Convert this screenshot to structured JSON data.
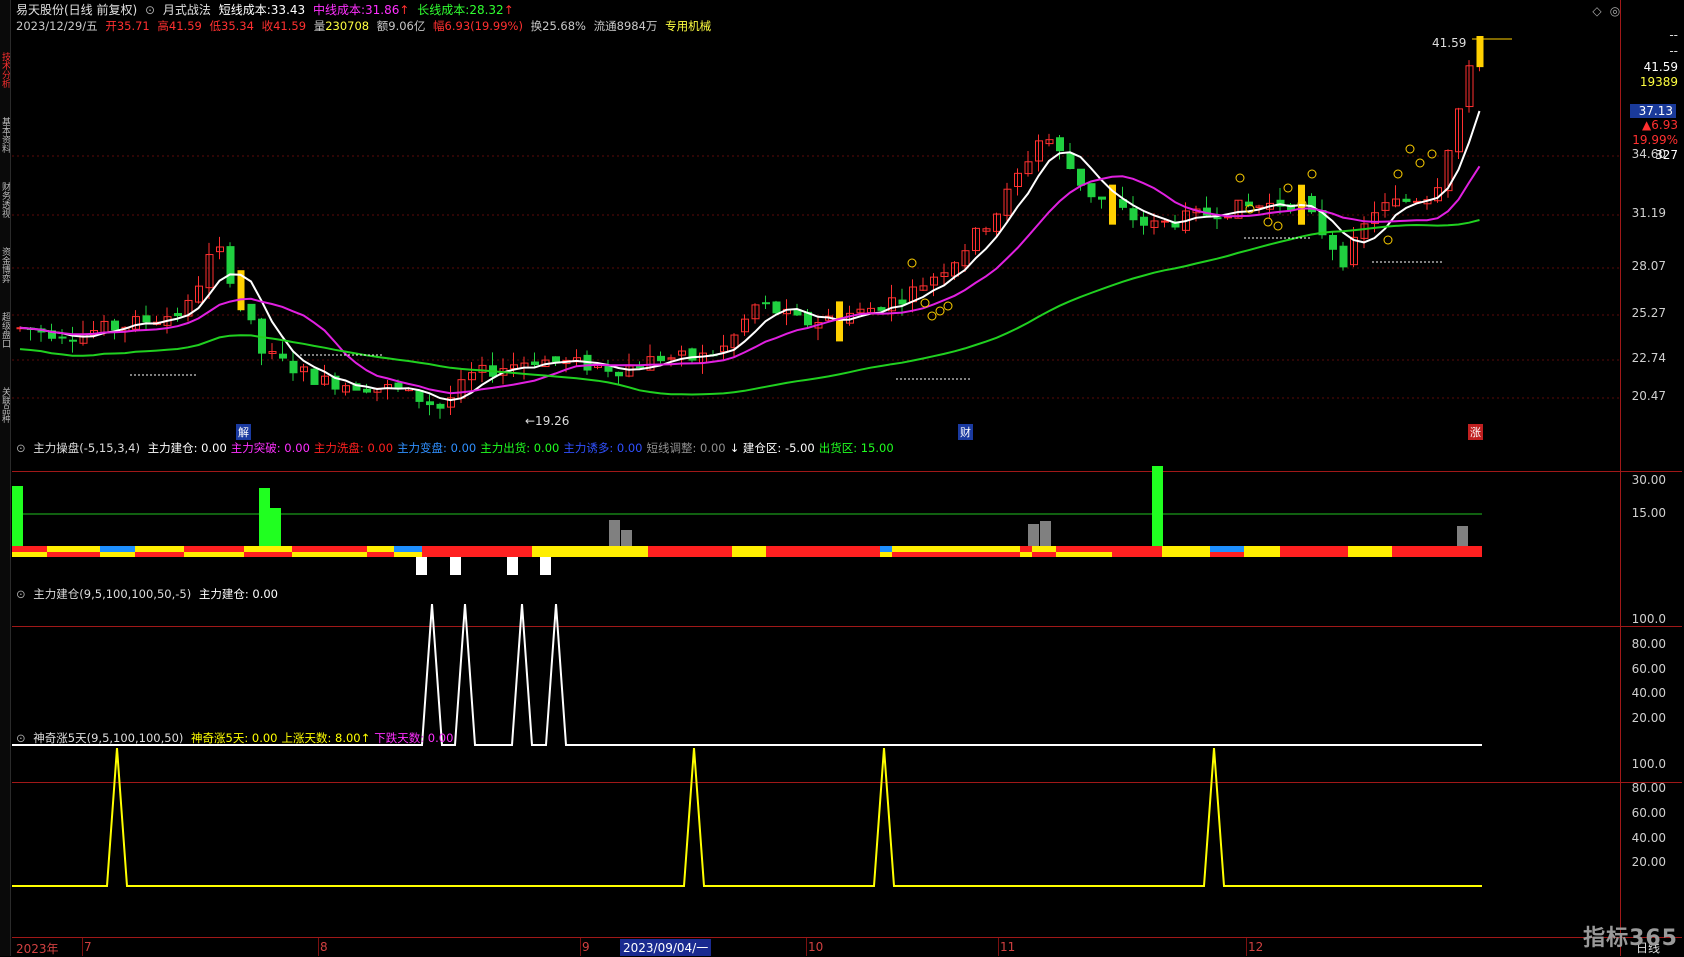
{
  "sidebar": {
    "tabs": [
      {
        "label": "技术分析",
        "active": true
      },
      {
        "label": "基本资料",
        "active": false
      },
      {
        "label": "财务透视",
        "active": false
      },
      {
        "label": "资金博弈",
        "active": false
      },
      {
        "label": "超级盘口",
        "active": false
      },
      {
        "label": "关联品种",
        "active": false
      }
    ]
  },
  "header": {
    "stock_name": "易天股份(日线 前复权)",
    "formula": "月式战法",
    "short_cost_label": "短线成本:",
    "short_cost": "33.43",
    "mid_cost_label": "中线成本:",
    "mid_cost": "31.86",
    "long_cost_label": "长线成本:",
    "long_cost": "28.32",
    "arrow_up": "↑",
    "date": "2023/12/29/五",
    "open_label": "开",
    "open": "35.71",
    "high_label": "高",
    "high": "41.59",
    "low_label": "低",
    "low": "35.34",
    "close_label": "收",
    "close": "41.59",
    "vol_label": "量",
    "vol": "230708",
    "amount_label": "额",
    "amount": "9.06亿",
    "chg_label": "幅",
    "chg": "6.93(19.99%)",
    "turnover_label": "换",
    "turnover": "25.68%",
    "float_label": "流通",
    "float": "8984万",
    "industry": "专用机械"
  },
  "right_panel": {
    "dashes": "--",
    "price": "41.59",
    "volume": "19389",
    "cur_price": "37.13",
    "change": "▲6.93",
    "change_pct": "19.99%",
    "count": "327",
    "hidden_price": "41.59"
  },
  "main_y_labels": [
    "34.60",
    "31.19",
    "28.07",
    "25.27",
    "22.74",
    "20.47"
  ],
  "annotations": {
    "low_price": "←19.26",
    "high_price": "41.59",
    "jie": "解",
    "cai": "财",
    "zhang": "涨"
  },
  "panel1": {
    "title": "主力操盘(-5,15,3,4)",
    "items": [
      {
        "label": "主力建仓:",
        "value": "0.00",
        "color": "#ffffff"
      },
      {
        "label": "主力突破:",
        "value": "0.00",
        "color": "#ff30ff"
      },
      {
        "label": "主力洗盘:",
        "value": "0.00",
        "color": "#ff2020"
      },
      {
        "label": "主力变盘:",
        "value": "0.00",
        "color": "#3090ff"
      },
      {
        "label": "主力出货:",
        "value": "0.00",
        "color": "#20ff20"
      },
      {
        "label": "主力诱多:",
        "value": "0.00",
        "color": "#3050ff"
      },
      {
        "label": "短线调整:",
        "value": "0.00",
        "color": "#909090"
      },
      {
        "label": "↓ 建仓区:",
        "value": "-5.00",
        "color": "#ffffff"
      },
      {
        "label": "出货区:",
        "value": "15.00",
        "color": "#20ff20"
      }
    ],
    "y_labels": [
      "30.00",
      "15.00"
    ]
  },
  "panel2": {
    "title": "主力建仓(9,5,100,100,50,-5)",
    "item_label": "主力建仓:",
    "item_value": "0.00",
    "y_labels": [
      "100.0",
      "80.00",
      "60.00",
      "40.00",
      "20.00"
    ]
  },
  "panel3": {
    "title": "神奇涨5天(9,5,100,100,50)",
    "items": [
      {
        "label": "神奇涨5天:",
        "value": "0.00",
        "color": "#ffff00"
      },
      {
        "label": "上涨天数:",
        "value": "8.00↑",
        "color": "#ffff00"
      },
      {
        "label": "下跌天数:",
        "value": "0.00",
        "color": "#ff30ff"
      }
    ],
    "y_labels": [
      "100.0",
      "80.00",
      "60.00",
      "40.00",
      "20.00"
    ]
  },
  "x_axis": {
    "labels": [
      "2023年",
      "7",
      "8",
      "9",
      "10",
      "11",
      "12"
    ],
    "cursor_date": "2023/09/04/一",
    "period": "日线"
  },
  "logo": {
    "text": "指标365"
  },
  "colors": {
    "up": "#ff3030",
    "down": "#20c020",
    "white_line": "#ffffff",
    "magenta_line": "#e020e0",
    "green_line": "#20d020",
    "yellow": "#ffff00",
    "grid": "#7a1010"
  },
  "chart_data": {
    "type": "candlestick",
    "title": "易天股份(日线 前复权)",
    "x_range": [
      "2023-06",
      "2023-12-29"
    ],
    "ylim": [
      19.26,
      41.59
    ],
    "last_bar": {
      "open": 35.71,
      "high": 41.59,
      "low": 35.34,
      "close": 41.59
    },
    "ma_lines": [
      {
        "name": "短线成本",
        "value": 33.43
      },
      {
        "name": "中线成本",
        "value": 31.86
      },
      {
        "name": "长线成本",
        "value": 28.32
      }
    ],
    "panel2_peaks": 4,
    "panel3_peaks": 4
  }
}
